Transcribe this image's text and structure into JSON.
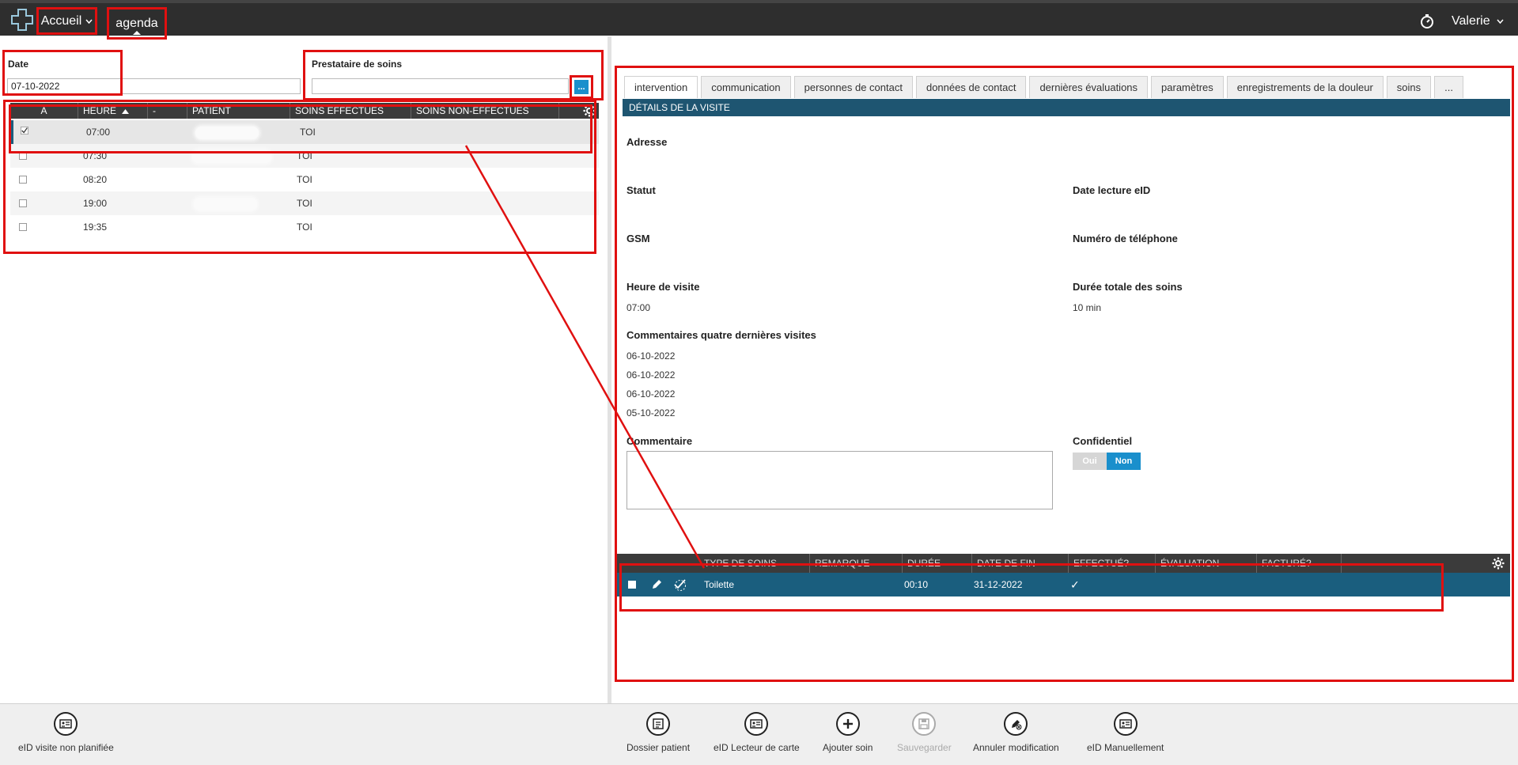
{
  "topbar": {
    "home_label": "Accueil",
    "agenda_label": "agenda",
    "user_name": "Valerie"
  },
  "filters": {
    "date_label": "Date",
    "date_value": "07-10-2022",
    "provider_label": "Prestataire de soins",
    "provider_value": "",
    "provider_browse_label": "..."
  },
  "agenda": {
    "columns": [
      "A",
      "HEURE",
      "-",
      "PATIENT",
      "SOINS EFFECTUÉS",
      "SOINS NON-EFFECTUÉS"
    ],
    "rows": [
      {
        "time": "07:00",
        "care": "TOI"
      },
      {
        "time": "07:30",
        "care": "TOI"
      },
      {
        "time": "08:20",
        "care": "TOI"
      },
      {
        "time": "19:00",
        "care": "TOI"
      },
      {
        "time": "19:35",
        "care": "TOI"
      }
    ]
  },
  "tabs": [
    "intervention",
    "communication",
    "personnes de contact",
    "données de contact",
    "dernières évaluations",
    "paramètres",
    "enregistrements de la douleur",
    "soins",
    "..."
  ],
  "details": {
    "section_title": "Détails de la visite",
    "address_label": "Adresse",
    "status_label": "Statut",
    "eid_date_label": "Date lecture eID",
    "gsm_label": "GSM",
    "phone_label": "Numéro de téléphone",
    "visit_time_label": "Heure de visite",
    "visit_time_value": "07:00",
    "total_duration_label": "Durée totale des soins",
    "total_duration_value": "10 min",
    "last_comments_label": "Commentaires quatre dernières visites",
    "last_comments": [
      "06-10-2022",
      "06-10-2022",
      "06-10-2022",
      "05-10-2022"
    ],
    "comment_label": "Commentaire",
    "confidential_label": "Confidentiel",
    "yes_label": "Oui",
    "no_label": "Non"
  },
  "care_table": {
    "columns": [
      "TYPE DE SOINS",
      "REMARQUE",
      "DURÉE",
      "DATE DE FIN",
      "EFFECTUÉ?",
      "ÉVALUATION",
      "FACTURÉ?"
    ],
    "row": {
      "type": "Toilette",
      "remark": "",
      "duration": "00:10",
      "end_date": "31-12-2022",
      "done": "✓"
    }
  },
  "toolbar": {
    "eid_unplanned": "eID visite non planifiée",
    "patient_file": "Dossier patient",
    "eid_card_reader": "eID Lecteur de carte",
    "add_care": "Ajouter soin",
    "save": "Sauvegarder",
    "cancel_edit": "Annuler modification",
    "eid_manual": "eID Manuellement"
  },
  "colors": {
    "topbar": "#2e2e2e",
    "accent": "#1a8fcc",
    "section": "#1e5571",
    "annotation": "#e01010"
  }
}
